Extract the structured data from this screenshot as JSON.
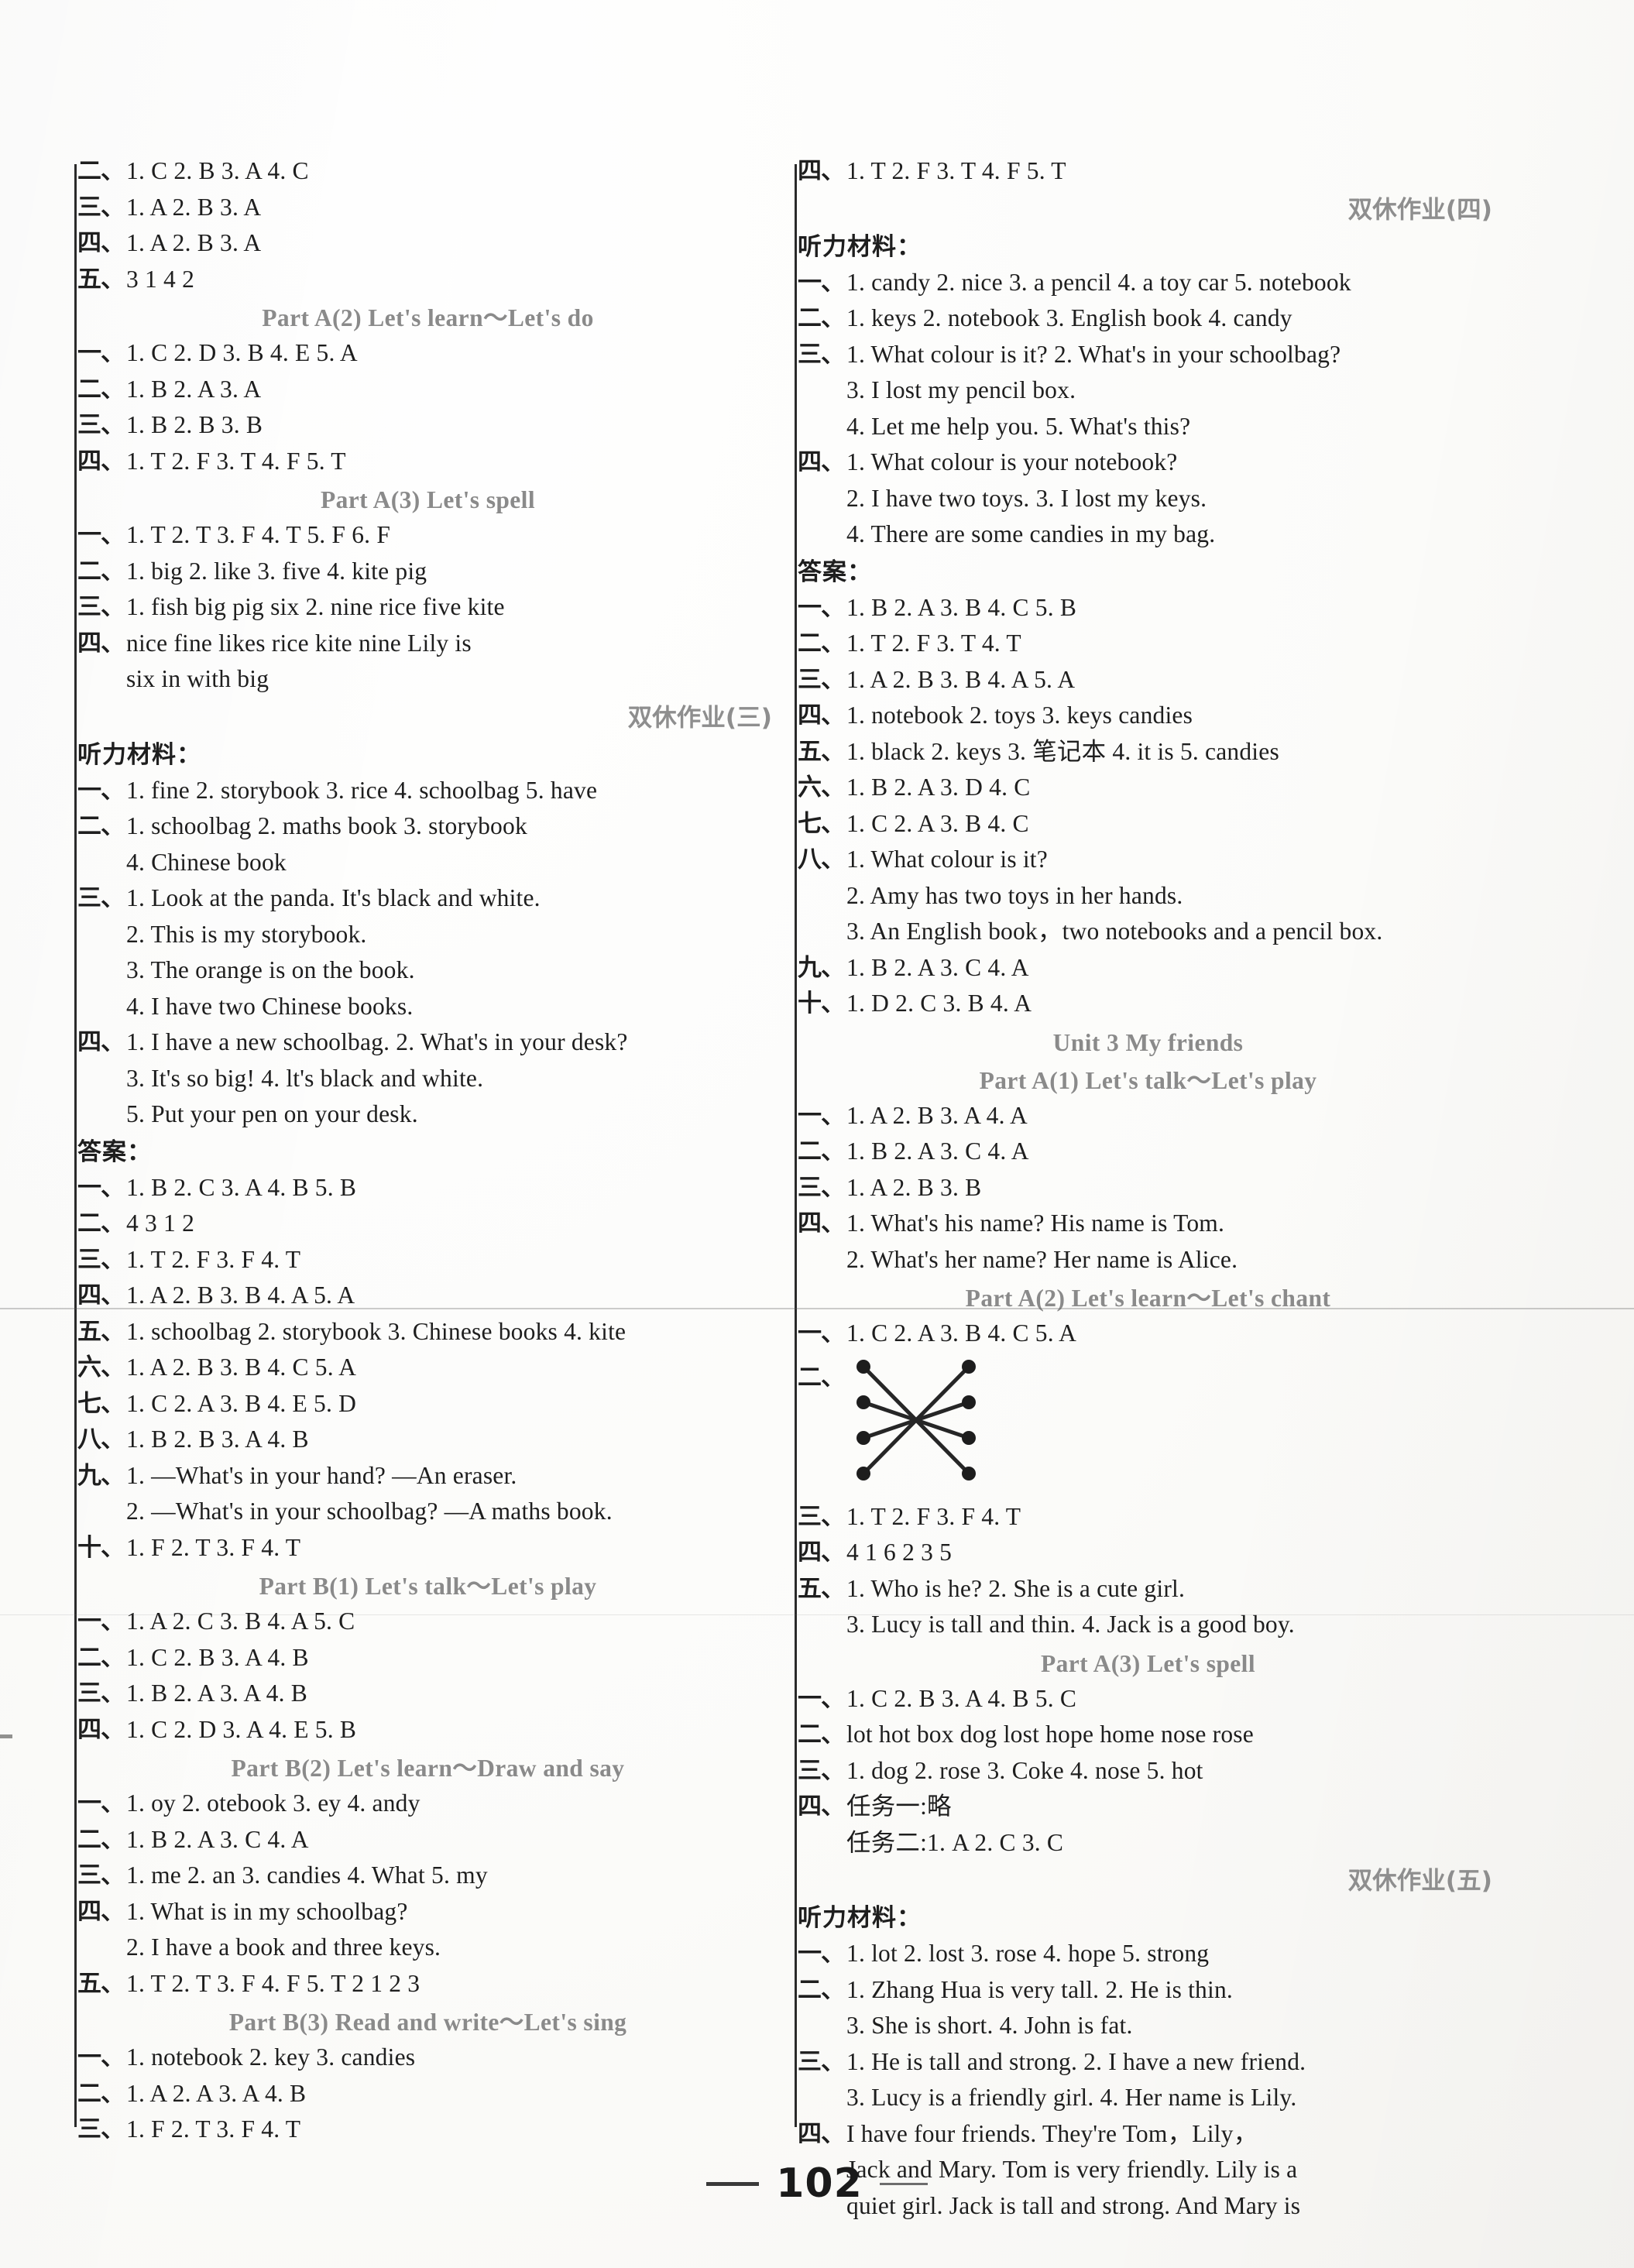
{
  "document": {
    "page_number": "102",
    "type": "answer-key"
  },
  "left_column": {
    "blocks": [
      {
        "kind": "answer",
        "num": "二、",
        "text": "1. C   2. B   3. A   4. C"
      },
      {
        "kind": "answer",
        "num": "三、",
        "text": "1. A   2. B   3. A"
      },
      {
        "kind": "answer",
        "num": "四、",
        "text": "1. A   2. B   3. A"
      },
      {
        "kind": "answer",
        "num": "五、",
        "text": "3   1   4   2"
      },
      {
        "kind": "heading",
        "text": "Part A(2)   Let's learn～Let's do"
      },
      {
        "kind": "answer",
        "num": "一、",
        "text": "1. C   2. D   3. B   4. E   5. A"
      },
      {
        "kind": "answer",
        "num": "二、",
        "text": "1. B   2. A   3. A"
      },
      {
        "kind": "answer",
        "num": "三、",
        "text": "1. B   2. B   3. B"
      },
      {
        "kind": "answer",
        "num": "四、",
        "text": "1. T   2. F   3. T   4. F   5. T"
      },
      {
        "kind": "heading",
        "text": "Part A(3)   Let's spell"
      },
      {
        "kind": "answer",
        "num": "一、",
        "text": "1. T   2. T   3. F   4. T   5. F   6. F"
      },
      {
        "kind": "answer",
        "num": "二、",
        "text": "1. big   2. like   3. five   4. kite   pig"
      },
      {
        "kind": "answer",
        "num": "三、",
        "text": "1. fish  big  pig  six  2. nine  rice  five  kite"
      },
      {
        "kind": "answer",
        "num": "四、",
        "text": "nice   fine   likes   rice   kite   nine   Lily   is"
      },
      {
        "kind": "cont",
        "text": "six   in   with   big"
      },
      {
        "kind": "heading-cn",
        "text": "双休作业(三)"
      },
      {
        "kind": "label",
        "text": "听力材料："
      },
      {
        "kind": "answer",
        "num": "一、",
        "text": "1. fine   2. storybook   3. rice   4. schoolbag   5. have"
      },
      {
        "kind": "answer",
        "num": "二、",
        "text": "1. schoolbag   2.  maths book   3. storybook"
      },
      {
        "kind": "cont",
        "text": "4. Chinese book"
      },
      {
        "kind": "answer",
        "num": "三、",
        "text": "1. Look at the panda.  It's black and white."
      },
      {
        "kind": "cont",
        "text": "2. This is my storybook."
      },
      {
        "kind": "cont",
        "text": "3. The orange is on the book."
      },
      {
        "kind": "cont",
        "text": "4. I have two Chinese books."
      },
      {
        "kind": "answer",
        "num": "四、",
        "text": "1. I have a new schoolbag.   2. What's in your desk?"
      },
      {
        "kind": "cont",
        "text": "3. It's so big!    4. lt's black and white."
      },
      {
        "kind": "cont",
        "text": "5. Put your pen on your desk."
      },
      {
        "kind": "label",
        "text": "答案："
      },
      {
        "kind": "answer",
        "num": "一、",
        "text": "1. B   2. C   3. A   4. B   5. B"
      },
      {
        "kind": "answer",
        "num": "二、",
        "text": "4   3   1   2"
      },
      {
        "kind": "answer",
        "num": "三、",
        "text": "1. T   2. F   3. F   4. T"
      },
      {
        "kind": "answer",
        "num": "四、",
        "text": "1. A   2. B   3. B   4. A   5. A"
      },
      {
        "kind": "answer",
        "num": "五、",
        "text": "1. schoolbag  2. storybook  3. Chinese books  4. kite"
      },
      {
        "kind": "answer",
        "num": "六、",
        "text": "1. A   2. B   3. B   4. C   5. A"
      },
      {
        "kind": "answer",
        "num": "七、",
        "text": "1. C   2. A   3. B   4. E   5. D"
      },
      {
        "kind": "answer",
        "num": "八、",
        "text": "1. B   2. B   3. A   4. B"
      },
      {
        "kind": "answer",
        "num": "九、",
        "text": "1. —What's in your hand?    —An eraser."
      },
      {
        "kind": "cont",
        "text": "2. —What's in your schoolbag?    —A maths book."
      },
      {
        "kind": "answer",
        "num": "十、",
        "text": "1. F   2. T   3. F   4. T"
      },
      {
        "kind": "heading",
        "text": "Part B(1)   Let's talk～Let's play"
      },
      {
        "kind": "answer",
        "num": "一、",
        "text": "1. A   2. C   3. B   4. A   5. C"
      },
      {
        "kind": "answer",
        "num": "二、",
        "text": "1. C   2. B   3. A   4. B"
      },
      {
        "kind": "answer",
        "num": "三、",
        "text": "1. B   2. A   3. A   4. B"
      },
      {
        "kind": "answer",
        "num": "四、",
        "text": "1. C   2. D   3. A   4. E   5. B"
      },
      {
        "kind": "heading",
        "text": "Part B(2)   Let's learn～Draw and say"
      },
      {
        "kind": "answer",
        "num": "一、",
        "text": "1. oy   2. otebook   3. ey   4. andy"
      },
      {
        "kind": "answer",
        "num": "二、",
        "text": "1. B   2. A   3. C   4. A"
      },
      {
        "kind": "answer",
        "num": "三、",
        "text": "1. me   2. an   3. candies   4. What   5. my"
      },
      {
        "kind": "answer",
        "num": "四、",
        "text": "1. What is in my schoolbag?"
      },
      {
        "kind": "cont",
        "text": "2. I have a book and three keys."
      },
      {
        "kind": "answer",
        "num": "五、",
        "text": "1. T   2. T   3. F   4. F   5. T        2   1   2   3"
      },
      {
        "kind": "heading",
        "text": "Part B(3)   Read and write～Let's sing"
      },
      {
        "kind": "answer",
        "num": "一、",
        "text": "1. notebook   2. key   3. candies"
      },
      {
        "kind": "answer",
        "num": "二、",
        "text": "1. A   2. A   3. A   4. B"
      },
      {
        "kind": "answer",
        "num": "三、",
        "text": "1. F   2. T   3. F   4. T"
      }
    ]
  },
  "right_column": {
    "blocks": [
      {
        "kind": "answer",
        "num": "四、",
        "text": "1. T   2. F   3. T   4. F   5. T"
      },
      {
        "kind": "heading-cn",
        "text": "双休作业(四)"
      },
      {
        "kind": "label",
        "text": "听力材料："
      },
      {
        "kind": "answer",
        "num": "一、",
        "text": "1. candy   2. nice   3. a pencil   4. a toy car   5. notebook"
      },
      {
        "kind": "answer",
        "num": "二、",
        "text": "1. keys   2. notebook   3. English book   4. candy"
      },
      {
        "kind": "answer",
        "num": "三、",
        "text": "1. What colour is it?     2. What's in your schoolbag?"
      },
      {
        "kind": "cont",
        "text": "3. I lost my pencil box."
      },
      {
        "kind": "cont",
        "text": "4. Let me help you.    5. What's this?"
      },
      {
        "kind": "answer",
        "num": "四、",
        "text": "1. What colour is your notebook?"
      },
      {
        "kind": "cont",
        "text": "2. I have two toys.    3. I lost my keys."
      },
      {
        "kind": "cont",
        "text": "4. There are some candies in my bag."
      },
      {
        "kind": "label",
        "text": "答案："
      },
      {
        "kind": "answer",
        "num": "一、",
        "text": "1. B   2. A   3. B   4. C   5. B"
      },
      {
        "kind": "answer",
        "num": "二、",
        "text": "1. T   2. F   3. T   4. T"
      },
      {
        "kind": "answer",
        "num": "三、",
        "text": "1. A   2. B   3. B   4. A   5. A"
      },
      {
        "kind": "answer",
        "num": "四、",
        "text": "1. notebook   2. toys   3. keys   candies"
      },
      {
        "kind": "answer",
        "num": "五、",
        "text": "1. black   2. keys   3. 笔记本   4. it is   5. candies"
      },
      {
        "kind": "answer",
        "num": "六、",
        "text": "1. B   2. A   3. D   4. C"
      },
      {
        "kind": "answer",
        "num": "七、",
        "text": "1. C   2. A   3. B   4. C"
      },
      {
        "kind": "answer",
        "num": "八、",
        "text": "1. What colour is it?"
      },
      {
        "kind": "cont",
        "text": "2. Amy has two toys in her hands."
      },
      {
        "kind": "cont",
        "text": "3. An English book，two notebooks and a pencil box."
      },
      {
        "kind": "answer",
        "num": "九、",
        "text": "1. B   2. A   3. C   4. A"
      },
      {
        "kind": "answer",
        "num": "十、",
        "text": "1. D   2. C   3. B   4. A"
      },
      {
        "kind": "heading",
        "text": "Unit 3   My friends"
      },
      {
        "kind": "heading",
        "text": "Part A(1)   Let's talk～Let's play"
      },
      {
        "kind": "answer",
        "num": "一、",
        "text": "1. A   2. B   3. A   4. A"
      },
      {
        "kind": "answer",
        "num": "二、",
        "text": "1. B   2. A   3. C   4. A"
      },
      {
        "kind": "answer",
        "num": "三、",
        "text": "1. A   2. B   3. B"
      },
      {
        "kind": "answer",
        "num": "四、",
        "text": "1. What's his name?     His name is Tom."
      },
      {
        "kind": "cont",
        "text": "2. What's her name?     Her name is Alice."
      },
      {
        "kind": "heading",
        "text": "Part A(2)   Let's learn～Let's chant"
      },
      {
        "kind": "answer",
        "num": "一、",
        "text": "1. C   2. A   3. B   4. C   5. A"
      },
      {
        "kind": "match",
        "num": "二、",
        "label": "matching-diagram"
      },
      {
        "kind": "answer",
        "num": "三、",
        "text": "1. T   2. F   3. F   4. T"
      },
      {
        "kind": "answer",
        "num": "四、",
        "text": "4   1   6   2   3   5"
      },
      {
        "kind": "answer",
        "num": "五、",
        "text": "1. Who is he?     2. She is a cute girl."
      },
      {
        "kind": "cont",
        "text": "3. Lucy is tall and thin.    4. Jack is a good boy."
      },
      {
        "kind": "heading",
        "text": "Part A(3)   Let's spell"
      },
      {
        "kind": "answer",
        "num": "一、",
        "text": "1. C   2. B   3. A   4. B   5. C"
      },
      {
        "kind": "answer",
        "num": "二、",
        "text": "lot  hot  box  dog  lost  hope  home  nose  rose"
      },
      {
        "kind": "answer",
        "num": "三、",
        "text": "1. dog   2. rose   3. Coke   4. nose   5. hot"
      },
      {
        "kind": "answer",
        "num": "四、",
        "text": "任务一:略"
      },
      {
        "kind": "cont",
        "text": "任务二:1. A   2. C   3. C"
      },
      {
        "kind": "heading-cn",
        "text": "双休作业(五)"
      },
      {
        "kind": "label",
        "text": "听力材料："
      },
      {
        "kind": "answer",
        "num": "一、",
        "text": "1. lot   2. lost   3. rose   4. hope   5. strong"
      },
      {
        "kind": "answer",
        "num": "二、",
        "text": "1. Zhang Hua is very tall.     2. He is thin."
      },
      {
        "kind": "cont",
        "text": "3. She is short.    4. John is fat."
      },
      {
        "kind": "answer",
        "num": "三、",
        "text": "1. He is tall and strong.    2. I have a new friend."
      },
      {
        "kind": "cont",
        "text": "3. Lucy is a friendly girl.    4. Her name is Lily."
      },
      {
        "kind": "answer",
        "num": "四、",
        "text": "      I have four friends. They're Tom，Lily，"
      },
      {
        "kind": "cont",
        "text": "Jack and Mary. Tom is very friendly. Lily is a"
      },
      {
        "kind": "cont",
        "text": "quiet girl. Jack is tall and strong. And Mary is"
      }
    ]
  },
  "match_diagram": {
    "left_dots": 4,
    "right_dots": 4,
    "connections": [
      [
        0,
        3
      ],
      [
        1,
        2
      ],
      [
        2,
        1
      ],
      [
        3,
        0
      ]
    ]
  }
}
